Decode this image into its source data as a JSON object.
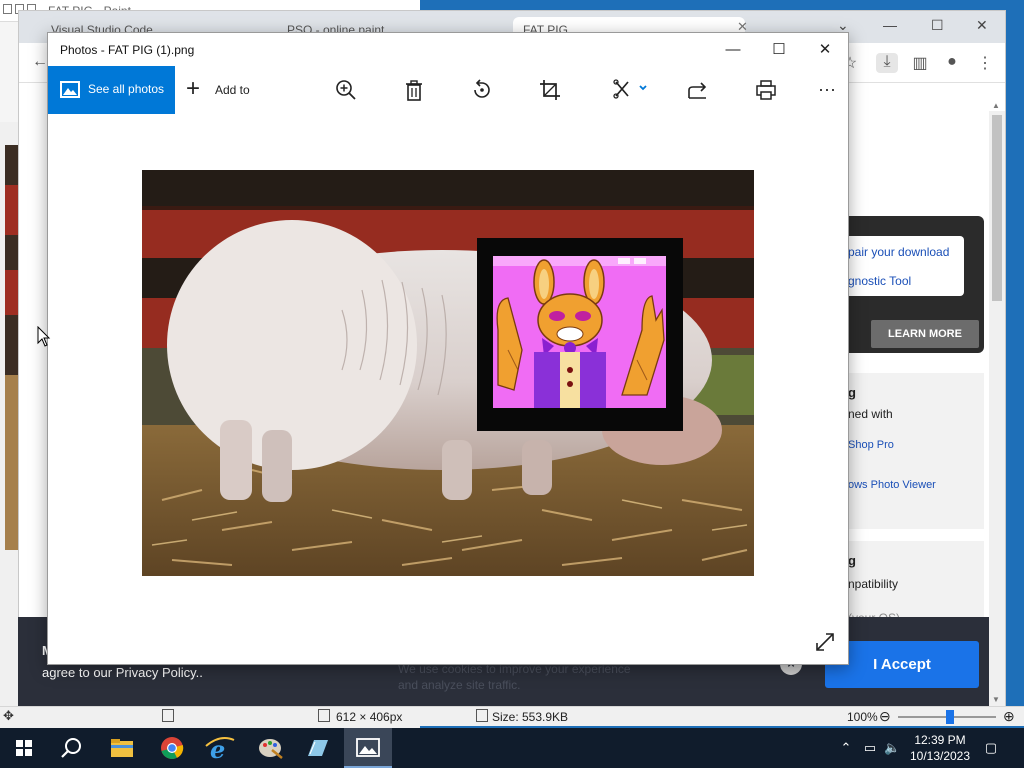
{
  "paint": {
    "title": "FAT PIG - Paint",
    "status": {
      "dimensions": "612 × 406px",
      "size": "Size: 553.9KB",
      "zoom": "100%"
    }
  },
  "browser": {
    "tabs": [
      {
        "label": "Visual Studio Code"
      },
      {
        "label": "PSQ - online paint"
      },
      {
        "label": "FAT PIG"
      }
    ],
    "ad": {
      "line1": "pair your download",
      "line2": "gnostic Tool",
      "learn_more": "LEARN MORE"
    },
    "info1": {
      "heading": "g",
      "opened_with": "ned with",
      "app1": "Shop Pro",
      "app2": "ows Photo Viewer"
    },
    "info2": {
      "heading": "g",
      "compat": "npatibility",
      "os": "(your OS)"
    },
    "cookie": {
      "lead": "M",
      "text": "agree to our Privacy Policy..",
      "ghost_line1": "We use cookies to improve your experience",
      "ghost_line2": "and analyze site traffic.",
      "accept": "I Accept",
      "dismiss": "×"
    }
  },
  "photos": {
    "title": "Photos - FAT PIG (1).png",
    "see_all": "See all photos",
    "add_to": "Add to",
    "tools": [
      "zoom-in",
      "delete",
      "rotate",
      "crop",
      "edit",
      "share",
      "print",
      "more"
    ],
    "more_label": "···"
  },
  "taskbar": {
    "time": "12:39 PM",
    "date": "10/13/2023"
  },
  "colors": {
    "accent": "#0078d7",
    "accept": "#1a73e8",
    "taskbar": "#101c2c",
    "sticker_pink": "#f06cf4",
    "bunny_orange": "#f0a030"
  }
}
